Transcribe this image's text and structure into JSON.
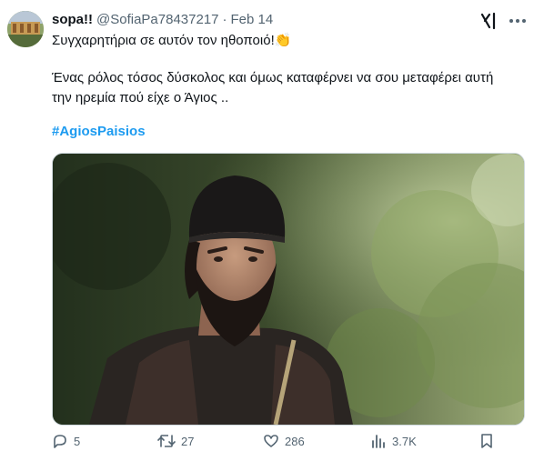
{
  "tweet": {
    "display_name": "sopa!!",
    "handle": "@SofiaPa78437217",
    "separator": "·",
    "date": "Feb 14",
    "text_line1": "Συγχαρητήρια σε αυτόν τον ηθοποιό!👏",
    "text_line2": "Ένας ρόλος τόσος δύσκολος και όμως καταφέρνει να σου μεταφέρει αυτή",
    "text_line3": "την ηρεμία πού είχε ο Άγιος ..",
    "hashtag": "#AgiosPaisios"
  },
  "actions": {
    "replies": "5",
    "reposts": "27",
    "likes": "286",
    "views": "3.7K"
  },
  "icons": {
    "grok": "grok-icon",
    "more": "more-dots-icon",
    "reply": "reply-icon",
    "repost": "repost-icon",
    "like": "heart-icon",
    "views": "bar-chart-icon",
    "bookmark": "bookmark-icon"
  },
  "colors": {
    "link": "#1d9bf0",
    "secondary_text": "#536471",
    "primary_text": "#0f1419"
  }
}
